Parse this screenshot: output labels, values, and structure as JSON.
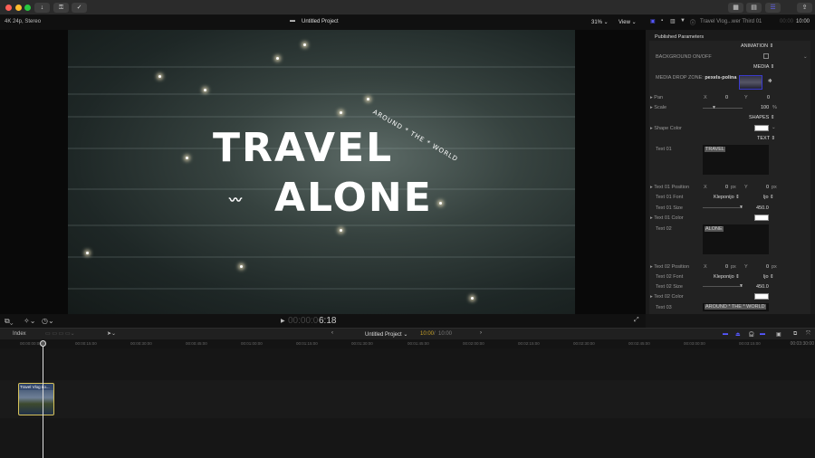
{
  "window": {
    "toolbar_buttons": [
      "download-icon",
      "key-icon",
      "checkmark-icon"
    ]
  },
  "viewer": {
    "format": "4K 24p, Stereo",
    "project_title": "Untitled Project",
    "zoom": "31%",
    "view_label": "View",
    "title_text_1": "TRAVEL",
    "title_text_2": "ALONE",
    "arc_text": "AROUND * THE * WORLD",
    "timecode_dim": "00:00:0",
    "timecode_bright": "6:18"
  },
  "inspector": {
    "clip_name": "Travel Vlog...wer Third 01",
    "duration_dim": "00:00",
    "duration": "10:00",
    "heading": "Published Parameters",
    "animation": "ANIMATION",
    "background_label": "BACKGROUND ON/OFF",
    "media": "MEDIA",
    "media_drop_label": "MEDIA DROP ZONE:",
    "media_drop_value": "pexels-polina",
    "pan_label": "Pan",
    "x": "X",
    "y": "Y",
    "pan_x": "0",
    "pan_y": "0",
    "scale_label": "Scale",
    "scale_value": "100",
    "percent": "%",
    "scale_slider": 0.4,
    "shapes": "SHAPES",
    "shape_color_label": "Shape Color",
    "text_section": "TEXT",
    "text01_label": "Text 01",
    "text01_value": "TRAVEL",
    "text01_pos_label": "Text 01 Position",
    "text01_pos_x": "0",
    "text01_pos_y": "0",
    "px": "px",
    "text01_font_label": "Text 01 Font",
    "text01_font": "Kleponijo",
    "text01_style": "ljo",
    "text01_size_label": "Text 01 Size",
    "text01_size": "450.0",
    "text01_color_label": "Text 01 Color",
    "text02_label": "Text 02",
    "text02_value": "ALONE",
    "text02_pos_label": "Text 02 Position",
    "text02_pos_x": "0",
    "text02_pos_y": "0",
    "text02_font_label": "Text 02 Font",
    "text02_font": "Kleponijo",
    "text02_style": "ljo",
    "text02_size_label": "Text 02 Size",
    "text02_size": "450.0",
    "text02_color_label": "Text 02 Color",
    "text03_label": "Text 03",
    "text03_value": "AROUND * THE * WORLD"
  },
  "timeline": {
    "index_label": "Index",
    "project": "Untitled Project",
    "position": "10:00",
    "separator": "/",
    "duration": "10:00",
    "ruler": [
      "00:00:00:00",
      "00:00:15:00",
      "00:00:30:00",
      "00:00:45:00",
      "00:01:00:00",
      "00:01:15:00",
      "00:01:30:00",
      "00:01:45:00",
      "00:02:00:00",
      "00:02:15:00",
      "00:02:30:00",
      "00:02:45:00",
      "00:03:00:00",
      "00:03:15:00",
      "00:03:30:00"
    ],
    "clip_name": "Travel Vlog Lo..."
  }
}
